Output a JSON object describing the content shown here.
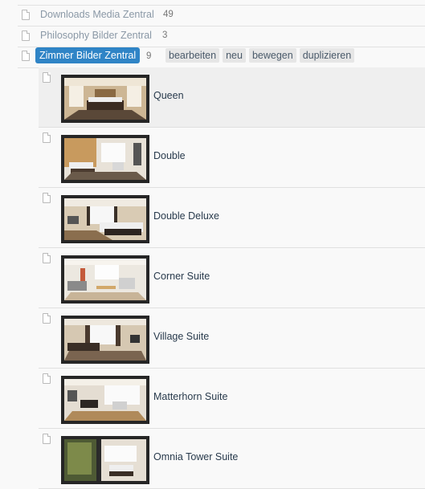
{
  "folders": [
    {
      "name": "Downloads Media Zentral",
      "count": "49"
    },
    {
      "name": "Philosophy Bilder Zentral",
      "count": "3"
    }
  ],
  "active_folder": {
    "name": "Zimmer Bilder Zentral",
    "count": "9",
    "actions": [
      "bearbeiten",
      "neu",
      "bewegen",
      "duplizieren"
    ]
  },
  "items": [
    {
      "name": "Queen",
      "selected": true
    },
    {
      "name": "Double"
    },
    {
      "name": "Double Deluxe"
    },
    {
      "name": "Corner Suite"
    },
    {
      "name": "Village Suite"
    },
    {
      "name": "Matterhorn Suite"
    },
    {
      "name": "Omnia Tower Suite"
    }
  ],
  "colors": {
    "accent": "#2f84c6",
    "folder_text": "#8a98a6",
    "item_text": "#283a4c",
    "background": "#f9f9f9",
    "selected_row": "#efefef"
  }
}
